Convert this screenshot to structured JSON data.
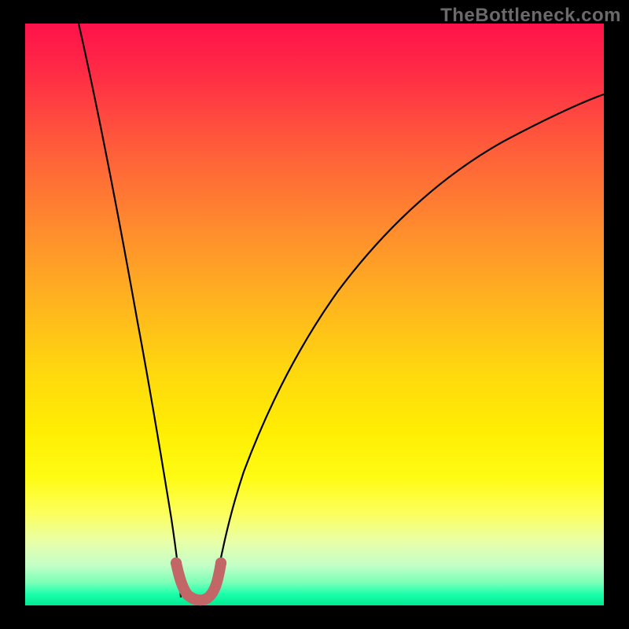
{
  "watermark": "TheBottleneck.com",
  "chart_data": {
    "type": "line",
    "title": "",
    "xlabel": "",
    "ylabel": "",
    "xlim": [
      0,
      100
    ],
    "ylim": [
      0,
      100
    ],
    "grid": false,
    "legend": false,
    "series": [
      {
        "name": "curve-left",
        "x": [
          9,
          12,
          15,
          18,
          21,
          23,
          24.5,
          25.5,
          26,
          26.3,
          26.6
        ],
        "y": [
          100,
          85,
          67,
          48,
          29,
          14,
          7,
          3,
          1.5,
          0.8,
          0.5
        ]
      },
      {
        "name": "dots",
        "x": [
          26.6,
          27.2,
          28.0,
          29.0,
          30.0,
          31.0,
          31.8,
          32.4
        ],
        "y": [
          7,
          4.2,
          2.4,
          1.6,
          1.6,
          2.4,
          4.2,
          7
        ]
      },
      {
        "name": "curve-right",
        "x": [
          32.4,
          33,
          35,
          38,
          42,
          48,
          56,
          66,
          78,
          90,
          100
        ],
        "y": [
          0.5,
          1.2,
          4,
          10,
          18,
          28,
          40,
          52,
          63,
          72,
          78
        ]
      }
    ],
    "colors": {
      "curve": "#000000",
      "dots": "#c26668"
    }
  }
}
